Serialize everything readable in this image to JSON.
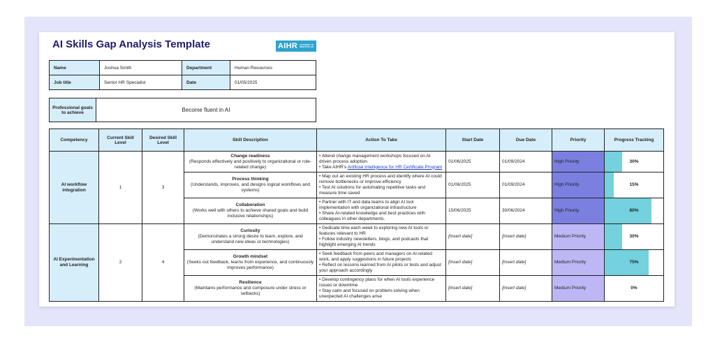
{
  "title": "AI Skills Gap Analysis Template",
  "logo": {
    "mark": "AIHR",
    "sub": "ACADEMY TO INNOVATE HR"
  },
  "info": {
    "name_label": "Name",
    "name_value": "Joshua Smith",
    "department_label": "Department",
    "department_value": "Human Resources",
    "job_label": "Job title",
    "job_value": "Senior HR Specialist",
    "date_label": "Date",
    "date_value": "01/05/2025"
  },
  "goals": {
    "label": "Professional goals to achieve",
    "value": "Become fluent in AI"
  },
  "columns": [
    "Competency",
    "Current Skill Level",
    "Desired Skill Level",
    "Skill Description",
    "Action To Take",
    "Start Date",
    "Due Date",
    "Priority",
    "Progress Tracking"
  ],
  "competencies": [
    {
      "name": "AI workflow integration",
      "current": "1",
      "desired": "3"
    },
    {
      "name": "AI Experimentation and Learning",
      "current": "2",
      "desired": "4"
    }
  ],
  "rows": [
    {
      "skill_name": "Change readiness",
      "skill_desc": "(Responds effectively and positively to organizational or role-related change)",
      "action_1": "• Attend change management workshops focused on AI driven process adoption",
      "action_2_prefix": "• Take AIHR's ",
      "action_2_link": "Artificial Intelligence for HR Certificate Program",
      "start": "01/06/2025",
      "due": "01/09/2024",
      "priority": "High Priority",
      "progress": "30%",
      "progress_value": 30
    },
    {
      "skill_name": "Process thinking",
      "skill_desc": "(Understands, improves, and designs logical workflows and systems)",
      "action": "• Map out an existing HR process and identify where AI could remove bottlenecks or improve efficiency\n• Test AI solutions for automating repetitive tasks and measure time saved",
      "start": "01/06/2025",
      "due": "01/09/2024",
      "priority": "High Priority",
      "progress": "15%",
      "progress_value": 15
    },
    {
      "skill_name": "Collaboration",
      "skill_desc": "(Works well with others to achieve shared goals and build inclusive relationships)",
      "action": "• Partner with IT and data teams to align AI tool implementation with organizational infrastructure\n• Share AI-related knowledge and best practices with colleagues in other departments.",
      "start": "15/06/2025",
      "due": "30/06/2024",
      "priority": "High Priority",
      "progress": "80%",
      "progress_value": 80
    },
    {
      "skill_name": "Curiosity",
      "skill_desc": "(Demonstrates a strong desire to learn, explore, and understand new ideas or technologies)",
      "action": "• Dedicate time each week to exploring new AI tools or features relevant to HR\n• Follow industry newsletters, blogs, and podcasts that highlight emerging AI trends",
      "start": "[Insert date]",
      "due": "[Insert date]",
      "priority": "Medium Priority",
      "progress": "30%",
      "progress_value": 30
    },
    {
      "skill_name": "Growth mindset",
      "skill_desc": "(Seeks out feedback, learns from experience, and continuously improves performance)",
      "action": "• Seek feedback from peers and managers on AI-related work, and apply suggestions in future projects\n• Reflect on lessons learned from AI pilots or tests and adjust your approach accordingly",
      "start": "[Insert date]",
      "due": "[Insert date]",
      "priority": "Medium Priority",
      "progress": "75%",
      "progress_value": 75
    },
    {
      "skill_name": "Resilience",
      "skill_desc": "(Maintains performance and composure under stress or setbacks)",
      "action": "• Develop contingency plans for when AI tools experience issues or downtime\n• Stay calm and focused on problem-solving when unexpected AI challenges arise",
      "start": "[Insert date]",
      "due": "[Insert date]",
      "priority": "Medium Priority",
      "progress": "0%",
      "progress_value": 0
    }
  ],
  "colors": {
    "header_fill": "#d6eefa",
    "high_priority": "#7b7fe0",
    "medium_priority": "#bdb8f5",
    "progress_bar": "#74d1de",
    "title": "#1f1c6b"
  }
}
